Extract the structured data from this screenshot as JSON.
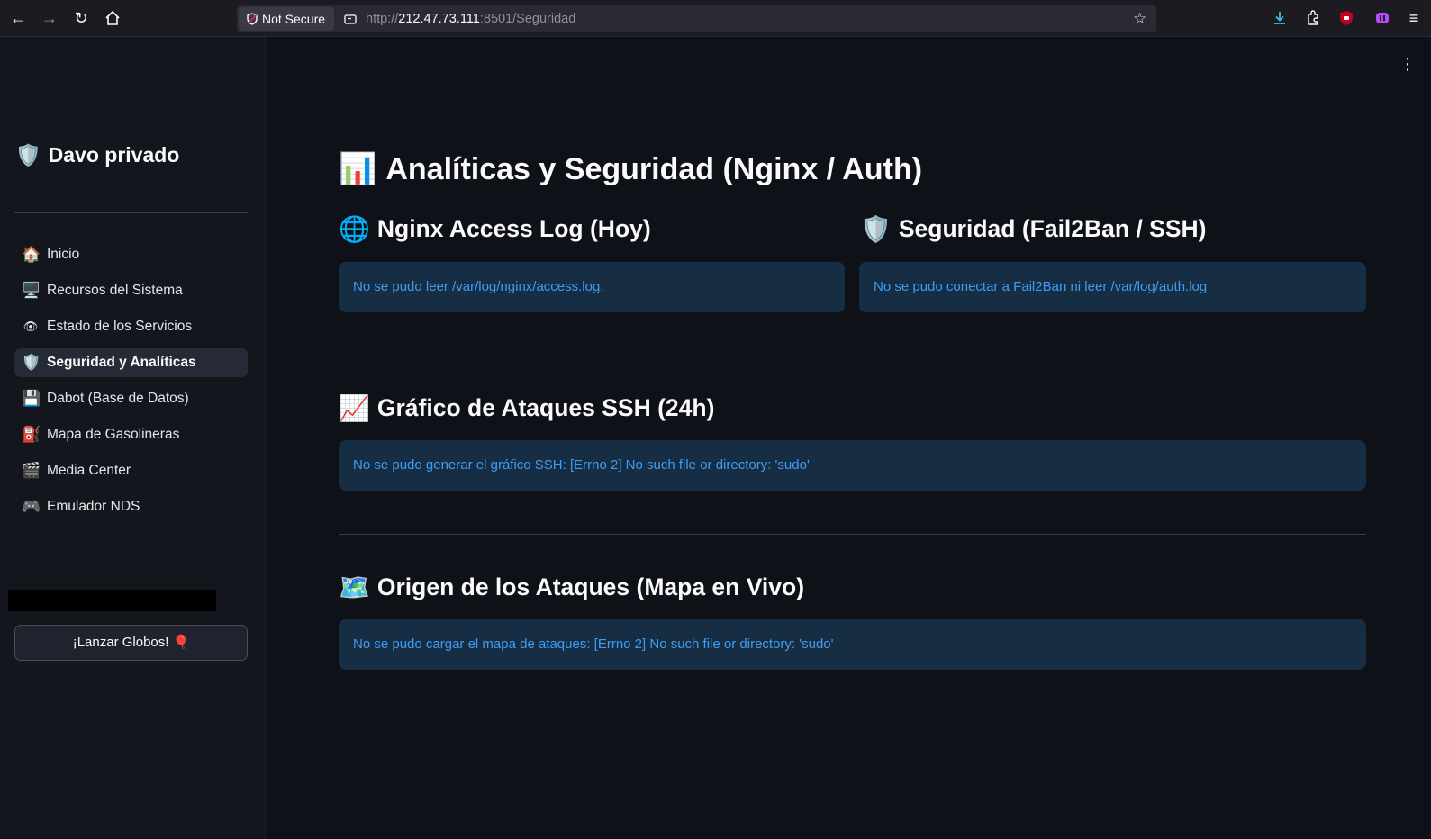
{
  "browser": {
    "security_label": "Not Secure",
    "url_scheme": "http://",
    "url_host": "212.47.73.111",
    "url_rest": ":8501/Seguridad"
  },
  "sidebar": {
    "brand_emoji": "🛡️",
    "brand": "Davo privado",
    "items": [
      {
        "emoji": "🏠",
        "label": "Inicio"
      },
      {
        "emoji": "🖥️",
        "label": "Recursos del Sistema"
      },
      {
        "emoji": "👁",
        "label": "Estado de los Servicios"
      },
      {
        "emoji": "🛡️",
        "label": "Seguridad y Analíticas",
        "active": true
      },
      {
        "emoji": "💾",
        "label": "Dabot (Base de Datos)"
      },
      {
        "emoji": "⛽",
        "label": "Mapa de Gasolineras"
      },
      {
        "emoji": "🎬",
        "label": "Media Center"
      },
      {
        "emoji": "🎮",
        "label": "Emulador NDS"
      }
    ],
    "button_label": "¡Lanzar Globos! 🎈"
  },
  "main": {
    "title_emoji": "📊",
    "title": "Analíticas y Seguridad (Nginx / Auth)",
    "nginx": {
      "emoji": "🌐",
      "heading": "Nginx Access Log (Hoy)",
      "message": "No se pudo leer /var/log/nginx/access.log."
    },
    "security": {
      "emoji": "🛡️",
      "heading": "Seguridad (Fail2Ban / SSH)",
      "message": "No se pudo conectar a Fail2Ban ni leer /var/log/auth.log"
    },
    "ssh_chart": {
      "emoji": "📈",
      "heading": "Gráfico de Ataques SSH (24h)",
      "message": "No se pudo generar el gráfico SSH: [Errno 2] No such file or directory: 'sudo'"
    },
    "attack_map": {
      "emoji": "🗺️",
      "heading": "Origen de los Ataques (Mapa en Vivo)",
      "message": "No se pudo cargar el mapa de ataques: [Errno 2] No such file or directory: 'sudo'"
    }
  }
}
